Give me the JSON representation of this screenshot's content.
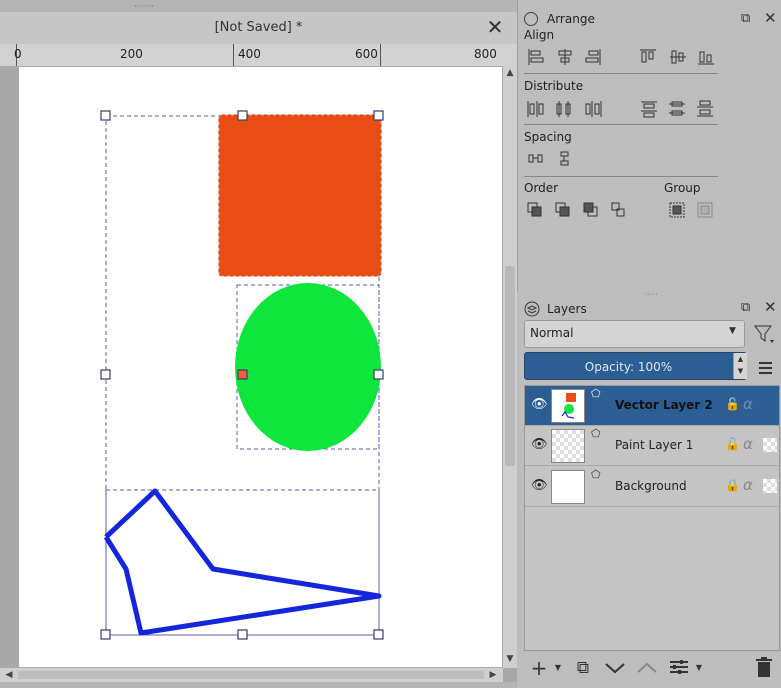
{
  "document": {
    "title": "[Not Saved]  *",
    "close_label": "✕",
    "ruler": {
      "ticks": [
        "0",
        "200",
        "400",
        "600",
        "800"
      ]
    }
  },
  "arrange": {
    "title": "Arrange",
    "align_label": "Align",
    "distribute_label": "Distribute",
    "spacing_label": "Spacing",
    "order_label": "Order",
    "group_label": "Group"
  },
  "layers": {
    "title": "Layers",
    "blend_mode": "Normal",
    "opacity_text": "Opacity:  100%",
    "items": [
      {
        "name": "Vector Layer 2",
        "active": true
      },
      {
        "name": "Paint Layer 1",
        "active": false
      },
      {
        "name": "Background",
        "active": false
      }
    ]
  },
  "colors": {
    "rectangle": "#e84e13",
    "ellipse": "#0ee63c",
    "path_stroke": "#1426dc",
    "selection": "#2c5d93"
  }
}
